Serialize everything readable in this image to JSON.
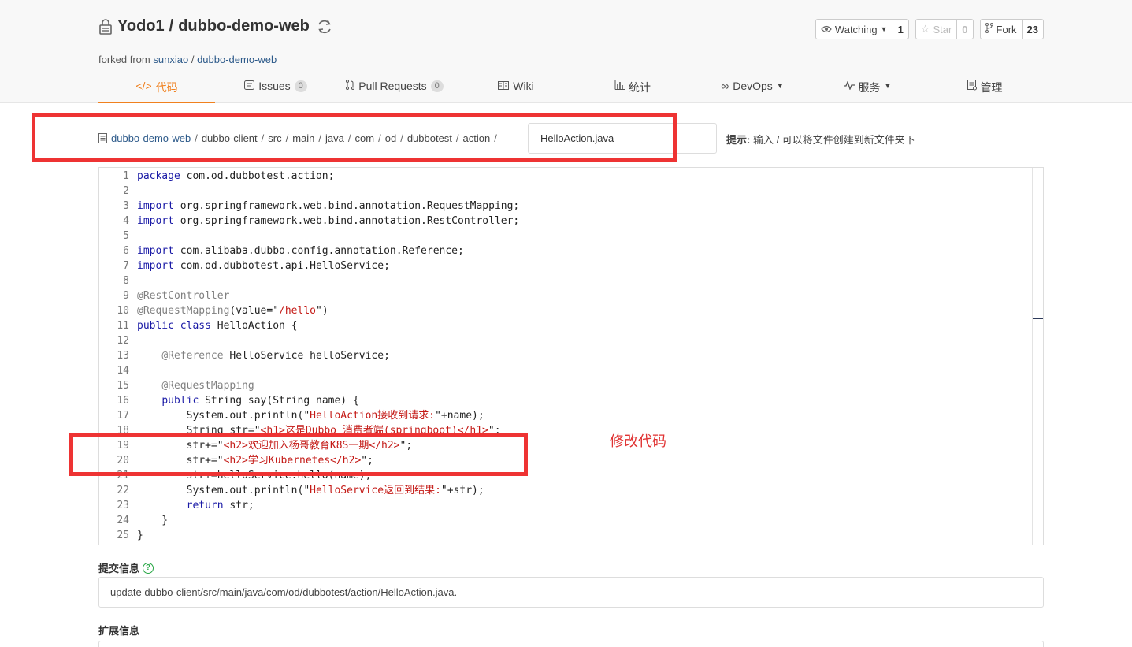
{
  "repo": {
    "owner": "Yodo1",
    "separator": "/",
    "name": "dubbo-demo-web",
    "forked_prefix": "forked from",
    "forked_owner": "sunxiao",
    "forked_name": "dubbo-demo-web"
  },
  "actions": {
    "watch_label": "Watching",
    "watch_count": "1",
    "star_label": "Star",
    "star_count": "0",
    "fork_label": "Fork",
    "fork_count": "23"
  },
  "nav": {
    "code": "代码",
    "issues": "Issues",
    "issues_count": "0",
    "pulls": "Pull Requests",
    "pulls_count": "0",
    "wiki": "Wiki",
    "stats": "统计",
    "devops": "DevOps",
    "service": "服务",
    "manage": "管理"
  },
  "breadcrumb": [
    "dubbo-demo-web",
    "dubbo-client",
    "src",
    "main",
    "java",
    "com",
    "od",
    "dubbotest",
    "action"
  ],
  "filename": "HelloAction.java",
  "hint": {
    "label": "提示:",
    "text": "输入 / 可以将文件创建到新文件夹下"
  },
  "code_lines": [
    "package com.od.dubbotest.action;",
    "",
    "import org.springframework.web.bind.annotation.RequestMapping;",
    "import org.springframework.web.bind.annotation.RestController;",
    "",
    "import com.alibaba.dubbo.config.annotation.Reference;",
    "import com.od.dubbotest.api.HelloService;",
    "",
    "@RestController",
    "@RequestMapping(value=\"/hello\")",
    "public class HelloAction {",
    "",
    "    @Reference HelloService helloService;",
    "",
    "    @RequestMapping",
    "    public String say(String name) {",
    "        System.out.println(\"HelloAction接收到请求:\"+name);",
    "        String str=\"<h1>这是Dubbo 消费者端(springboot)</h1>\";",
    "        str+=\"<h2>欢迎加入杨哥教育K8S一期</h2>\";",
    "        str+=\"<h2>学习Kubernetes</h2>\";",
    "        str+=helloService.hello(name);",
    "        System.out.println(\"HelloService返回到结果:\"+str);",
    "        return str;",
    "    }",
    "}"
  ],
  "commit": {
    "label": "提交信息",
    "value": "update dubbo-client/src/main/java/com/od/dubbotest/action/HelloAction.java."
  },
  "extended": {
    "label": "扩展信息"
  },
  "annotation": {
    "note": "修改代码",
    "color": "#ee3333"
  },
  "colors": {
    "accent": "#f0811f",
    "link": "#2d5a8a",
    "keyword": "#1a1aa6",
    "string": "#c41a16"
  }
}
